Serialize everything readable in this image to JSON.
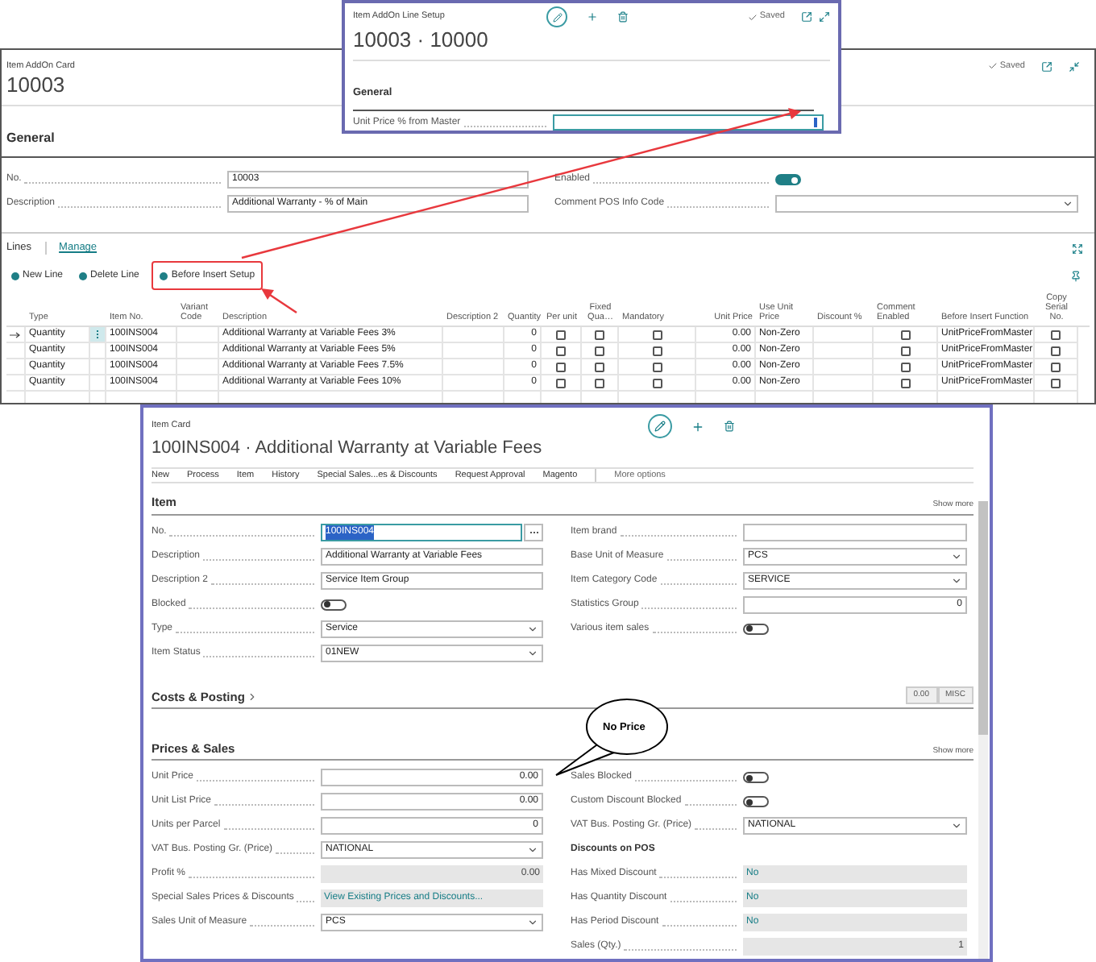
{
  "addon_card": {
    "caption": "Item AddOn Card",
    "title": "10003",
    "saved": "Saved",
    "section": "General",
    "fields_left": [
      {
        "label": "No.",
        "kind": "text",
        "value": "10003"
      },
      {
        "label": "Description",
        "kind": "text",
        "value": "Additional Warranty - % of Main"
      }
    ],
    "fields_right": [
      {
        "label": "Enabled",
        "kind": "toggle",
        "on": true
      },
      {
        "label": "Comment POS Info Code",
        "kind": "select"
      }
    ],
    "lines": {
      "title": "Lines",
      "menu": "Manage",
      "actions": [
        {
          "label": "New Line",
          "highlighted": false
        },
        {
          "label": "Delete Line",
          "highlighted": false
        },
        {
          "label": "Before Insert Setup",
          "highlighted": true
        }
      ],
      "columns": [
        "Type",
        "Item No.",
        "Variant Code",
        "Description",
        "Description 2",
        "Quantity",
        "Per unit",
        "Fixed Qua…",
        "Mandatory",
        "Unit Price",
        "Use Unit Price",
        "Discount %",
        "Comment Enabled",
        "Before Insert Function",
        "Copy Serial No."
      ],
      "rows": [
        {
          "selected": true,
          "type": "Quantity",
          "item_no": "100INS004",
          "description": "Additional Warranty at Variable Fees 3%",
          "quantity": "0",
          "per_unit": false,
          "fixed_quantity": false,
          "mandatory": false,
          "unit_price": "0.00",
          "use_unit_price": "Non-Zero",
          "comment_enabled": false,
          "before_insert_function": "UnitPriceFromMaster",
          "copy_serial_no": false
        },
        {
          "selected": false,
          "type": "Quantity",
          "item_no": "100INS004",
          "description": "Additional Warranty at Variable Fees 5%",
          "quantity": "0",
          "per_unit": false,
          "fixed_quantity": false,
          "mandatory": false,
          "unit_price": "0.00",
          "use_unit_price": "Non-Zero",
          "comment_enabled": false,
          "before_insert_function": "UnitPriceFromMaster",
          "copy_serial_no": false
        },
        {
          "selected": false,
          "type": "Quantity",
          "item_no": "100INS004",
          "description": "Additional Warranty at Variable Fees 7.5%",
          "quantity": "0",
          "per_unit": false,
          "fixed_quantity": false,
          "mandatory": false,
          "unit_price": "0.00",
          "use_unit_price": "Non-Zero",
          "comment_enabled": false,
          "before_insert_function": "UnitPriceFromMaster",
          "copy_serial_no": false
        },
        {
          "selected": false,
          "type": "Quantity",
          "item_no": "100INS004",
          "description": "Additional Warranty at Variable Fees 10%",
          "quantity": "0",
          "per_unit": false,
          "fixed_quantity": false,
          "mandatory": false,
          "unit_price": "0.00",
          "use_unit_price": "Non-Zero",
          "comment_enabled": false,
          "before_insert_function": "UnitPriceFromMaster",
          "copy_serial_no": false
        }
      ]
    }
  },
  "line_setup_window": {
    "caption": "Item AddOn Line Setup",
    "saved": "Saved",
    "title": "10003 · 10000",
    "section": "General",
    "field_label": "Unit Price % from Master"
  },
  "item_card": {
    "caption": "Item Card",
    "title": "100INS004 · Additional Warranty at Variable Fees",
    "menu": [
      "New",
      "Process",
      "Item",
      "History",
      "Special Sales...es & Discounts",
      "Request Approval",
      "Magento"
    ],
    "more": "More options",
    "item_section": {
      "title": "Item",
      "show_more": "Show more",
      "left": [
        {
          "label": "No.",
          "kind": "lookup",
          "value": "100INS004",
          "focused": true
        },
        {
          "label": "Description",
          "kind": "text",
          "value": "Additional Warranty at Variable Fees"
        },
        {
          "label": "Description 2",
          "kind": "text",
          "value": "Service Item Group"
        },
        {
          "label": "Blocked",
          "kind": "toggle",
          "on": false
        },
        {
          "label": "Type",
          "kind": "select",
          "value": "Service"
        },
        {
          "label": "Item Status",
          "kind": "select",
          "value": "01NEW"
        }
      ],
      "right": [
        {
          "label": "Item brand",
          "kind": "text"
        },
        {
          "label": "Base Unit of Measure",
          "kind": "select",
          "value": "PCS"
        },
        {
          "label": "Item Category Code",
          "kind": "select",
          "value": "SERVICE"
        },
        {
          "label": "Statistics Group",
          "kind": "number",
          "value": "0"
        },
        {
          "label": "Various item sales",
          "kind": "toggle",
          "on": false
        }
      ]
    },
    "costs_section": {
      "title": "Costs & Posting",
      "summary": [
        "0.00",
        "MISC"
      ]
    },
    "prices_section": {
      "title": "Prices & Sales",
      "show_more": "Show more",
      "left": [
        {
          "label": "Unit Price",
          "kind": "number",
          "value": "0.00"
        },
        {
          "label": "Unit List Price",
          "kind": "number",
          "value": "0.00"
        },
        {
          "label": "Units per Parcel",
          "kind": "number",
          "value": "0"
        },
        {
          "label": "VAT Bus. Posting Gr. (Price)",
          "kind": "select",
          "value": "NATIONAL"
        },
        {
          "label": "Profit %",
          "kind": "readonly",
          "value": "0.00"
        },
        {
          "label": "Special Sales Prices & Discounts",
          "kind": "link",
          "value": "View Existing Prices and Discounts..."
        },
        {
          "label": "Sales Unit of Measure",
          "kind": "select",
          "value": "PCS"
        }
      ],
      "right": [
        {
          "label": "Sales Blocked",
          "kind": "toggle",
          "on": false
        },
        {
          "label": "Custom Discount Blocked",
          "kind": "toggle",
          "on": false
        },
        {
          "label": "VAT Bus. Posting Gr. (Price)",
          "kind": "select",
          "value": "NATIONAL"
        },
        {
          "label": "Discounts on POS",
          "kind": "heading"
        },
        {
          "label": "Has Mixed Discount",
          "kind": "link",
          "value": "No"
        },
        {
          "label": "Has Quantity Discount",
          "kind": "link",
          "value": "No"
        },
        {
          "label": "Has Period Discount",
          "kind": "link",
          "value": "No"
        },
        {
          "label": "Sales (Qty.)",
          "kind": "readonly",
          "value": "1"
        }
      ]
    }
  },
  "callout": {
    "text": "No Price"
  }
}
